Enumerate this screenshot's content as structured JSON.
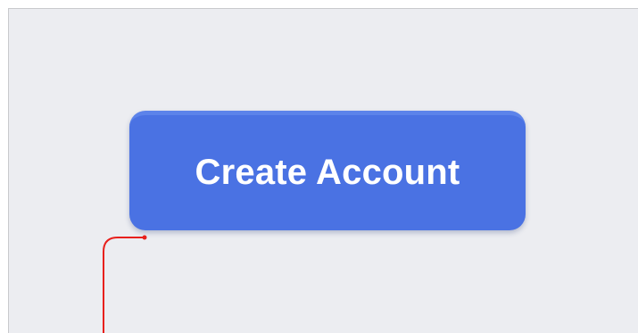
{
  "create_account_button": {
    "label": "Create Account"
  },
  "colors": {
    "canvas_background": "#ecedf1",
    "button_background": "#4a72e3",
    "button_text": "#ffffff",
    "annotation_line": "#e8201c"
  }
}
